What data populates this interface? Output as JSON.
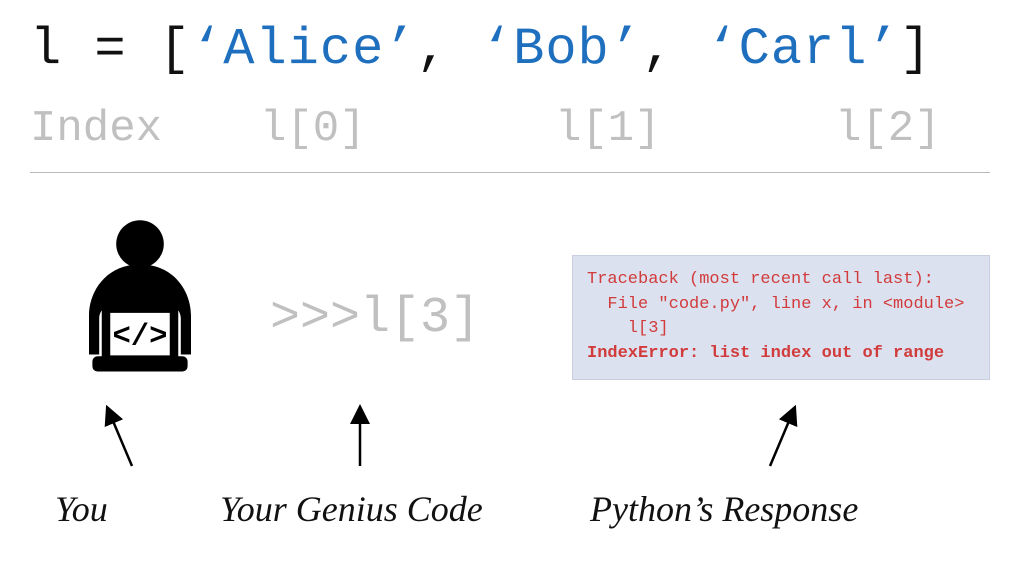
{
  "code": {
    "var_part": "l = ",
    "open_bracket": "[",
    "close_bracket": "]",
    "comma": ",",
    "strings": [
      "‘Alice’",
      "‘Bob’",
      "‘Carl’"
    ]
  },
  "index": {
    "label": "Index",
    "items": [
      "l[0]",
      "l[1]",
      "l[2]"
    ]
  },
  "prompt": {
    "chevrons": ">>>",
    "expr": "l[3]"
  },
  "traceback": {
    "line1": "Traceback (most recent call last):",
    "line2": "  File \"code.py\", line x, in <module>",
    "line3": "    l[3]",
    "error": "IndexError: list index out of range"
  },
  "labels": {
    "you": "You",
    "code": "Your Genius Code",
    "response": "Python’s Response"
  },
  "colors": {
    "string_blue": "#1f6fbf",
    "muted_gray": "#c0c0c0",
    "tb_bg": "#dbe1ef",
    "tb_red": "#d23b3b"
  }
}
